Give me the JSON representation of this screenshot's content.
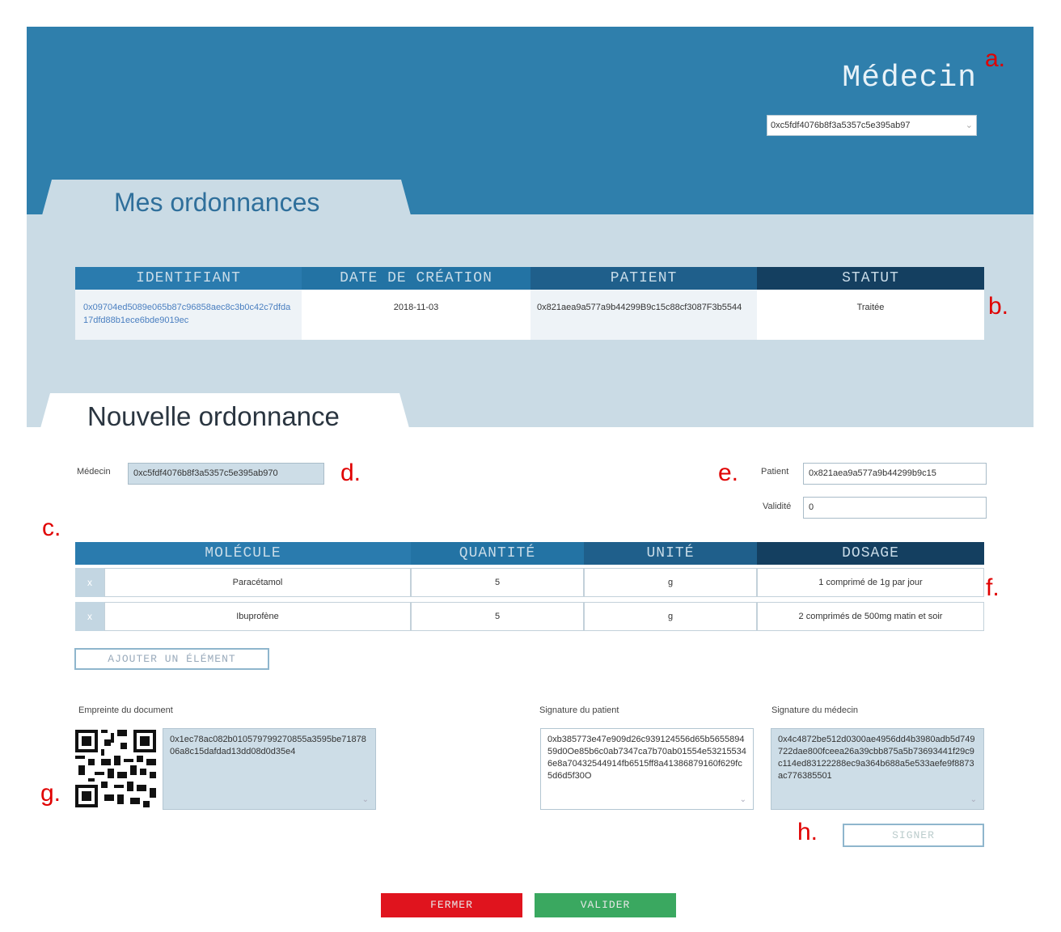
{
  "header": {
    "role_title": "Médecin",
    "account_select": "0xc5fdf4076b8f3a5357c5e395ab97"
  },
  "tabs": {
    "prescriptions": "Mes ordonnances",
    "new_prescription": "Nouvelle ordonnance"
  },
  "prescriptions_table": {
    "headers": [
      "IDENTIFIANT",
      "DATE DE CRÉATION",
      "PATIENT",
      "STATUT"
    ],
    "rows": [
      {
        "id": "0x09704ed5089e065b87c96858aec8c3b0c42c7dfda17dfd88b1ece6bde9019ec",
        "date": "2018-11-03",
        "patient": "0x821aea9a577a9b44299B9c15c88cf3087F3b5544",
        "status": "Traitée"
      }
    ]
  },
  "form": {
    "doctor_label": "Médecin",
    "doctor_value": "0xc5fdf4076b8f3a5357c5e395ab970",
    "patient_label": "Patient",
    "patient_value": "0x821aea9a577a9b44299b9c15",
    "validity_label": "Validité",
    "validity_value": "0"
  },
  "molecules_table": {
    "headers": [
      "MOLÉCULE",
      "QUANTITÉ",
      "UNITÉ",
      "DOSAGE"
    ],
    "remove_icon": "x",
    "rows": [
      {
        "molecule": "Paracétamol",
        "quantity": "5",
        "unit": "g",
        "dosage": "1 comprimé de 1g par jour"
      },
      {
        "molecule": "Ibuprofène",
        "quantity": "5",
        "unit": "g",
        "dosage": "2 comprimés de 500mg matin et soir"
      }
    ],
    "add_button": "AJOUTER UN ÉLÉMENT"
  },
  "signatures": {
    "fingerprint_label": "Empreinte du document",
    "fingerprint_value": "0x1ec78ac082b010579799270855a3595be7187806a8c15dafdad13dd08d0d35e4",
    "patient_label": "Signature du patient",
    "patient_value": "0xb385773e47e909d26c939124556d65b565589459d0Oe85b6c0ab7347ca7b70ab01554e532155346e8a70432544914fb6515ff8a41386879160f629fc5d6d5f30O",
    "doctor_label": "Signature du médecin",
    "doctor_value": "0x4c4872be512d0300ae4956dd4b3980adb5d749722dae800fceea26a39cbb875a5b73693441f29c9c114ed83122288ec9a364b688a5e533aefe9f8873ac776385501",
    "sign_button": "SIGNER"
  },
  "actions": {
    "close_button": "FERMER",
    "validate_button": "VALIDER"
  },
  "markers": {
    "a": "a.",
    "b": "b.",
    "c": "c.",
    "d": "d.",
    "e": "e.",
    "f": "f.",
    "g": "g.",
    "h": "h."
  },
  "colors": {
    "header_blue": "#2f7fac",
    "light_blue": "#cadbe5",
    "close_red": "#e0141e",
    "validate_green": "#3aa860",
    "marker_red": "#e00000"
  }
}
